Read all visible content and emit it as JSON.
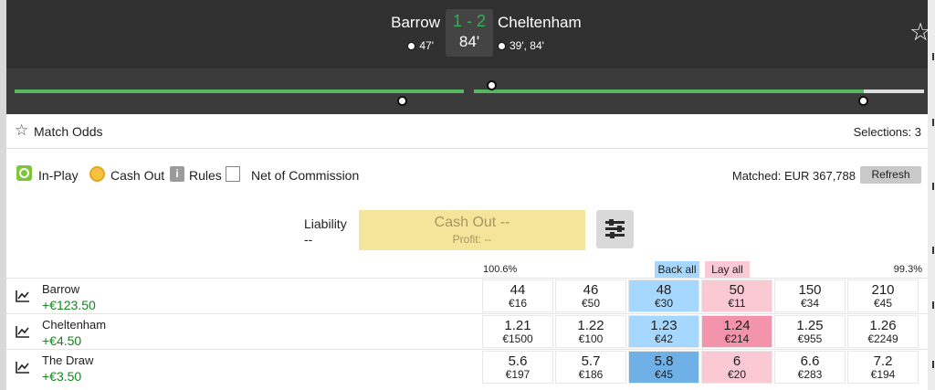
{
  "match": {
    "home_team": "Barrow",
    "away_team": "Cheltenham",
    "score": "1 - 2",
    "minute": "84'",
    "home_goals": "47'",
    "away_goals": "39', 84'"
  },
  "market": {
    "name": "Match Odds",
    "selections": "Selections: 3",
    "inplay_label": "In-Play",
    "cashout_label": "Cash Out",
    "rules_icon_text": "i",
    "rules_label": "Rules",
    "net_commission_label": "Net of Commission",
    "matched": "Matched: EUR 367,788",
    "refresh_label": "Refresh"
  },
  "cashout": {
    "liability_label": "Liability",
    "liability_value": "--",
    "title": "Cash Out --",
    "profit": "Profit: --"
  },
  "book": {
    "back_pct": "100.6%",
    "lay_pct": "99.3%",
    "back_all_label": "Back all",
    "lay_all_label": "Lay all"
  },
  "runners": [
    {
      "name": "Barrow",
      "pl": "+€123.50",
      "prices": [
        {
          "odds": "44",
          "size": "€16"
        },
        {
          "odds": "46",
          "size": "€50"
        },
        {
          "odds": "48",
          "size": "€30"
        },
        {
          "odds": "50",
          "size": "€11"
        },
        {
          "odds": "150",
          "size": "€34"
        },
        {
          "odds": "210",
          "size": "€45"
        }
      ]
    },
    {
      "name": "Cheltenham",
      "pl": "+€4.50",
      "prices": [
        {
          "odds": "1.21",
          "size": "€1500"
        },
        {
          "odds": "1.22",
          "size": "€100"
        },
        {
          "odds": "1.23",
          "size": "€42"
        },
        {
          "odds": "1.24",
          "size": "€214"
        },
        {
          "odds": "1.25",
          "size": "€955"
        },
        {
          "odds": "1.26",
          "size": "€2249"
        }
      ]
    },
    {
      "name": "The Draw",
      "pl": "+€3.50",
      "prices": [
        {
          "odds": "5.6",
          "size": "€197"
        },
        {
          "odds": "5.7",
          "size": "€186"
        },
        {
          "odds": "5.8",
          "size": "€45"
        },
        {
          "odds": "6",
          "size": "€20"
        },
        {
          "odds": "6.6",
          "size": "€283"
        },
        {
          "odds": "7.2",
          "size": "€194"
        }
      ]
    }
  ],
  "colors": {
    "header_bg": "#303030",
    "score_green": "#2fb34e",
    "timeline_green": "#55b861",
    "back_light": "#a6d8ff",
    "back_best": "#6fb1e6",
    "lay_light": "#fac9d4",
    "lay_best": "#f394ac",
    "profit_green": "#15861c"
  }
}
